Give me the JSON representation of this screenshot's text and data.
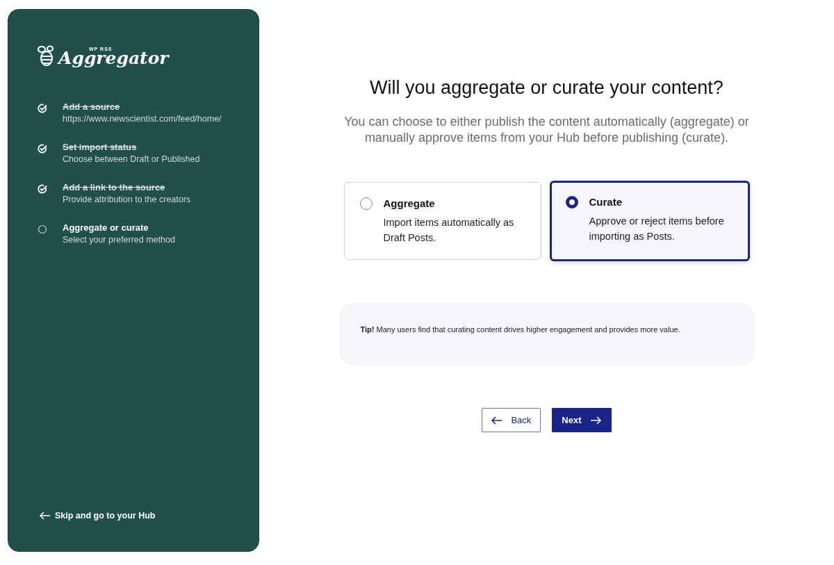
{
  "logo": {
    "small_text": "WP RSS",
    "name": "Aggregator"
  },
  "steps": [
    {
      "title": "Add a source",
      "subtitle": "https://www.newscientist.com/feed/home/",
      "done": true
    },
    {
      "title": "Set import status",
      "subtitle": "Choose between Draft or Published",
      "done": true
    },
    {
      "title": "Add a link to the source",
      "subtitle": "Provide attribution to the creators",
      "done": true
    },
    {
      "title": "Aggregate or curate",
      "subtitle": "Select your preferred method",
      "done": false
    }
  ],
  "skip_link": "Skip and go to your Hub",
  "heading": "Will you aggregate or curate your content?",
  "description": "You can choose to either publish the content automatically (aggregate) or manually approve items from your Hub before publishing (curate).",
  "options": [
    {
      "title": "Aggregate",
      "description": "Import items automatically as Draft Posts.",
      "selected": false
    },
    {
      "title": "Curate",
      "description": "Approve or reject items before importing as Posts.",
      "selected": true
    }
  ],
  "tip": "**Tip!** Many users find that curating content drives higher engagement and provides more value.",
  "buttons": {
    "back": "Back",
    "next": "Next"
  }
}
